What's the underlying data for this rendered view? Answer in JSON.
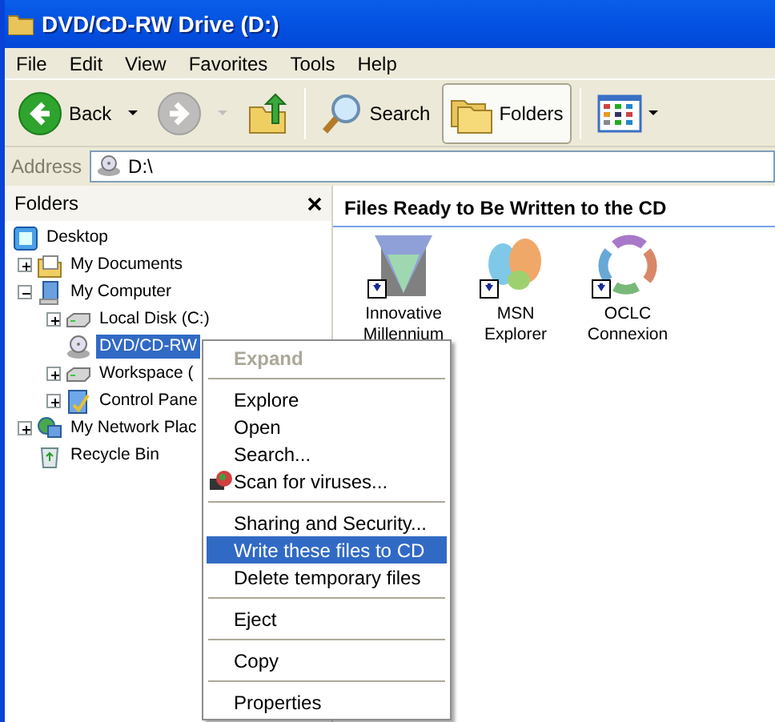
{
  "window": {
    "title": "DVD/CD-RW Drive (D:)"
  },
  "menu_bar": [
    "File",
    "Edit",
    "View",
    "Favorites",
    "Tools",
    "Help"
  ],
  "toolbar": [
    {
      "kind": "back",
      "label": "Back",
      "disabled": false
    },
    {
      "kind": "forward",
      "disabled": true
    },
    {
      "kind": "up"
    },
    {
      "kind": "separator"
    },
    {
      "kind": "search",
      "label": "Search",
      "selected": false
    },
    {
      "kind": "folders",
      "label": "Folders",
      "selected": true
    },
    {
      "kind": "separator"
    },
    {
      "kind": "views"
    }
  ],
  "address": {
    "label": "Address",
    "value": "D:\\"
  },
  "folders_pane": {
    "title": "Folders",
    "tree": [
      {
        "label": "Desktop",
        "kind": "desktop",
        "selected": false,
        "children": [
          {
            "label": "My Documents",
            "kind": "documents",
            "expanded": false,
            "selected": false
          },
          {
            "label": "My Computer",
            "kind": "computer",
            "expanded": true,
            "selected": false,
            "children": [
              {
                "label": "Local Disk (C:)",
                "kind": "disk",
                "expanded": false,
                "selected": false
              },
              {
                "label": "DVD/CD-RW",
                "kind": "cd",
                "selected": true
              },
              {
                "label": "Workspace (",
                "kind": "disk",
                "expanded": false,
                "selected": false
              },
              {
                "label": "Control Pane",
                "kind": "control",
                "expanded": false,
                "selected": false
              }
            ]
          },
          {
            "label": "My Network Plac",
            "kind": "network",
            "expanded": false,
            "selected": false
          },
          {
            "label": "Recycle Bin",
            "kind": "recycle",
            "selected": false
          }
        ]
      }
    ]
  },
  "files_pane": {
    "title": "Files Ready to Be Written to the CD",
    "files": [
      {
        "name": "Innovative Millennium",
        "kind": "triangle"
      },
      {
        "name": "MSN Explorer",
        "kind": "butterfly"
      },
      {
        "name": "OCLC Connexion",
        "kind": "rings"
      }
    ]
  },
  "context_menu": [
    {
      "kind": "command",
      "label": "Expand",
      "disabled": true,
      "default": true,
      "selected": false
    },
    {
      "kind": "separator"
    },
    {
      "kind": "command",
      "label": "Explore",
      "disabled": false,
      "selected": false
    },
    {
      "kind": "command",
      "label": "Open",
      "disabled": false,
      "selected": false
    },
    {
      "kind": "command",
      "label": "Search...",
      "disabled": false,
      "selected": false
    },
    {
      "kind": "scan",
      "label": "Scan for viruses...",
      "disabled": false,
      "selected": false
    },
    {
      "kind": "separator"
    },
    {
      "kind": "command",
      "label": "Sharing and Security...",
      "disabled": false,
      "selected": false
    },
    {
      "kind": "command",
      "label": "Write these files to CD",
      "disabled": false,
      "selected": true
    },
    {
      "kind": "command",
      "label": "Delete temporary files",
      "disabled": false,
      "selected": false
    },
    {
      "kind": "separator"
    },
    {
      "kind": "command",
      "label": "Eject",
      "disabled": false,
      "selected": false
    },
    {
      "kind": "separator"
    },
    {
      "kind": "command",
      "label": "Copy",
      "disabled": false,
      "selected": false
    },
    {
      "kind": "separator"
    },
    {
      "kind": "command",
      "label": "Properties",
      "disabled": false,
      "selected": false
    }
  ]
}
